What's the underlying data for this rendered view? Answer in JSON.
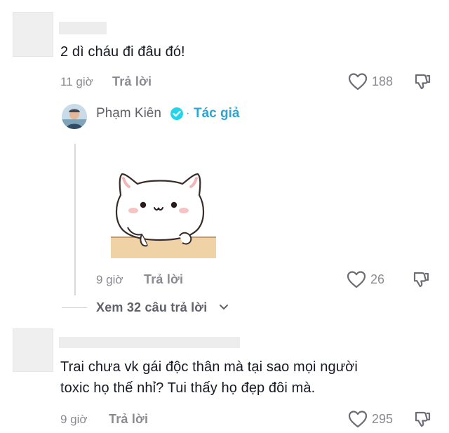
{
  "comments": [
    {
      "text": "2 dì cháu đi đâu đó!",
      "time": "11 giờ",
      "reply_label": "Trả lời",
      "likes": "188"
    },
    {
      "text_line1": "Trai chưa vk gái độc thân mà tại sao mọi người",
      "text_line2": "toxic họ thế nhỉ? Tui thấy họ đẹp đôi mà.",
      "time": "9 giờ",
      "reply_label": "Trả lời",
      "likes": "295"
    }
  ],
  "reply": {
    "author": "Phạm Kiên",
    "author_tag": "Tác giả",
    "separator": "·",
    "sticker": "white-cat-sticker",
    "time": "9 giờ",
    "reply_label": "Trả lời",
    "likes": "26"
  },
  "view_more": {
    "label": "Xem 32 câu trả lời"
  },
  "colors": {
    "text": "#161823",
    "muted": "#8a8b91",
    "verified": "#20d5ec",
    "author_tag": "#2aa6d6"
  },
  "icons": {
    "like": "heart-outline-icon",
    "dislike": "thumbs-down-icon",
    "verified": "verified-badge-icon",
    "chevron": "chevron-down-icon"
  }
}
